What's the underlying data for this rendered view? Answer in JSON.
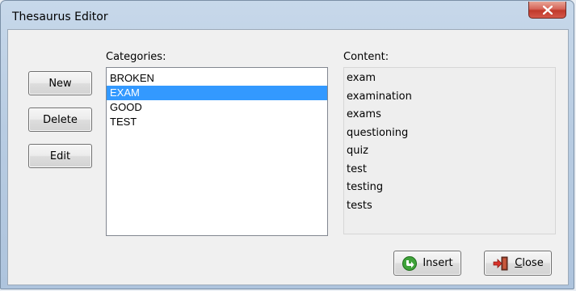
{
  "window": {
    "title": "Thesaurus Editor"
  },
  "side_buttons": {
    "new": "New",
    "delete": "Delete",
    "edit": "Edit"
  },
  "categories": {
    "label": "Categories:",
    "items": [
      "BROKEN",
      "EXAM",
      "GOOD",
      "TEST"
    ],
    "selected": "EXAM"
  },
  "content": {
    "label": "Content:",
    "items": [
      "exam",
      "examination",
      "exams",
      "questioning",
      "quiz",
      "test",
      "testing",
      "tests"
    ]
  },
  "bottom_buttons": {
    "insert": {
      "label": "Insert",
      "icon": "insert-arrow-icon"
    },
    "close": {
      "label": "Close",
      "mnemonic": "C",
      "rest": "lose",
      "icon": "exit-door-icon"
    }
  },
  "colors": {
    "selection": "#3399ff",
    "close_button": "#c0392b",
    "titlebar": "#b8cce2"
  }
}
